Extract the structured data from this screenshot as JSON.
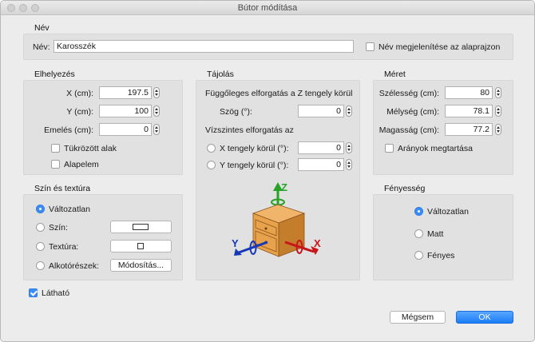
{
  "window": {
    "title": "Bútor módítása"
  },
  "name_section": {
    "title": "Név",
    "label": "Név:",
    "value": "Karosszék",
    "show_label": "Név megjelenítése az alaprajzon",
    "show_checked": false
  },
  "placement": {
    "title": "Elhelyezés",
    "x_label": "X (cm):",
    "x_value": "197.5",
    "y_label": "Y (cm):",
    "y_value": "100",
    "elev_label": "Emelés (cm):",
    "elev_value": "0",
    "mirror_label": "Tükrözött alak",
    "mirror_checked": false,
    "base_label": "Alapelem",
    "base_checked": false
  },
  "orientation": {
    "title": "Tájolás",
    "vertical_title": "Függőleges elforgatás a Z tengely körül",
    "angle_label": "Szög (°):",
    "angle_value": "0",
    "horizontal_title": "Vízszintes elforgatás az",
    "x_axis_label": "X tengely körül (°):",
    "x_axis_value": "0",
    "y_axis_label": "Y tengely körül (°):",
    "y_axis_value": "0",
    "axis_labels": {
      "z": "Z",
      "y": "Y",
      "x": "X"
    }
  },
  "size": {
    "title": "Méret",
    "width_label": "Szélesség (cm):",
    "width_value": "80",
    "depth_label": "Mélység (cm):",
    "depth_value": "78.1",
    "height_label": "Magasság (cm):",
    "height_value": "77.2",
    "keep_ratio_label": "Arányok megtartása",
    "keep_ratio_checked": false
  },
  "color_texture": {
    "title": "Szín és textúra",
    "unchanged_label": "Változatlan",
    "color_label": "Szín:",
    "texture_label": "Textúra:",
    "parts_label": "Alkotórészek:",
    "modify_button": "Módosítás...",
    "selected": "unchanged"
  },
  "brightness": {
    "title": "Fényesség",
    "unchanged_label": "Változatlan",
    "matt_label": "Matt",
    "shiny_label": "Fényes",
    "selected": "unchanged"
  },
  "visible": {
    "label": "Látható",
    "checked": true
  },
  "buttons": {
    "cancel": "Mégsem",
    "ok": "OK"
  },
  "colors": {
    "accent": "#3b8df5",
    "z_axis": "#27a227",
    "x_axis": "#c8151b",
    "y_axis": "#1637b8"
  }
}
